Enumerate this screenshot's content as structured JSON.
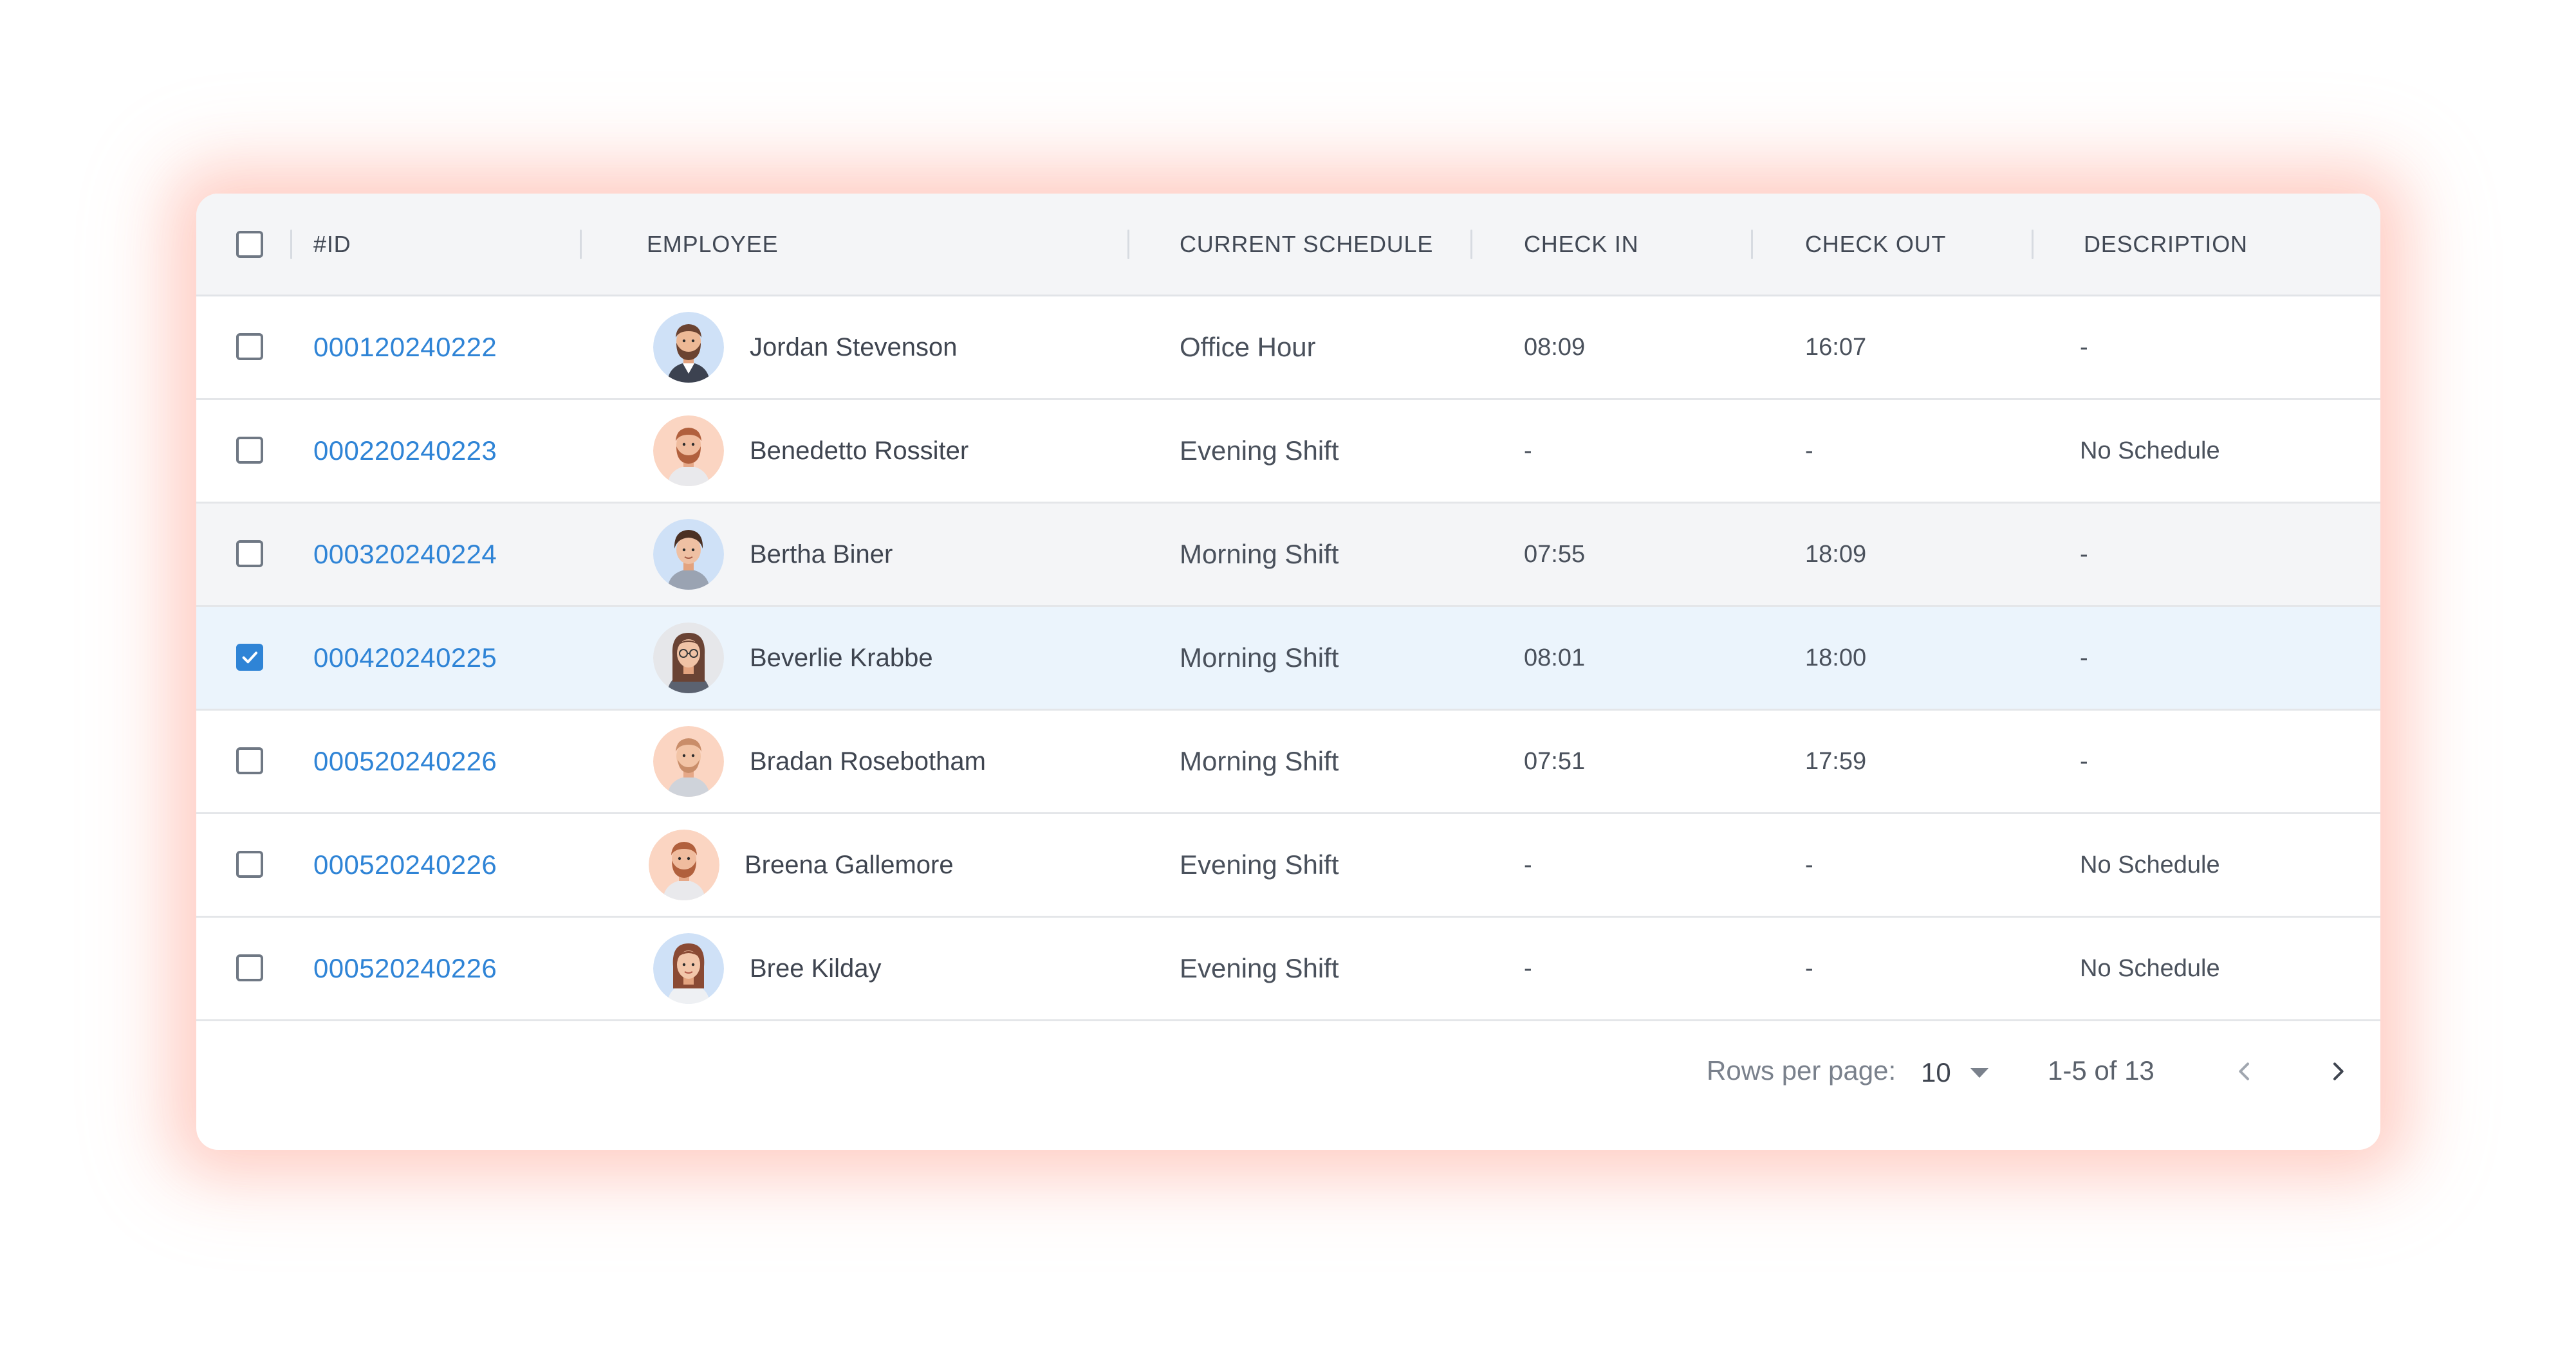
{
  "table": {
    "columns": {
      "id": "#ID",
      "employee": "EMPLOYEE",
      "schedule": "CURRENT SCHEDULE",
      "check_in": "CHECK IN",
      "check_out": "CHECK OUT",
      "description": "DESCRIPTION"
    },
    "rows": [
      {
        "id": "000120240222",
        "name": "Jordan Stevenson",
        "schedule": "Office Hour",
        "check_in": "08:09",
        "check_out": "16:07",
        "description": "-",
        "checked": false
      },
      {
        "id": "000220240223",
        "name": "Benedetto Rossiter",
        "schedule": "Evening Shift",
        "check_in": "-",
        "check_out": "-",
        "description": "No Schedule",
        "checked": false
      },
      {
        "id": "000320240224",
        "name": "Bertha Biner",
        "schedule": "Morning Shift",
        "check_in": "07:55",
        "check_out": "18:09",
        "description": "-",
        "checked": false
      },
      {
        "id": "000420240225",
        "name": "Beverlie Krabbe",
        "schedule": "Morning Shift",
        "check_in": "08:01",
        "check_out": "18:00",
        "description": "-",
        "checked": true
      },
      {
        "id": "000520240226",
        "name": "Bradan Rosebotham",
        "schedule": "Morning Shift",
        "check_in": "07:51",
        "check_out": "17:59",
        "description": "-",
        "checked": false
      },
      {
        "id": "000520240226",
        "name": "Breena Gallemore",
        "schedule": "Evening Shift",
        "check_in": "-",
        "check_out": "-",
        "description": "No Schedule",
        "checked": false
      },
      {
        "id": "000520240226",
        "name": "Bree Kilday",
        "schedule": "Evening Shift",
        "check_in": "-",
        "check_out": "-",
        "description": "No Schedule",
        "checked": false
      }
    ]
  },
  "pagination": {
    "rows_per_page_label": "Rows per page:",
    "rows_per_page_value": "10",
    "range_text": "1-5 of 13",
    "prev_icon": "chevron-left-icon",
    "next_icon": "chevron-right-icon"
  },
  "colors": {
    "accent": "#2f84d6",
    "selected_row": "#ebf4fc",
    "hover_row": "#f4f5f7",
    "header_bg": "#f4f5f7",
    "glow": "#ff785f"
  }
}
